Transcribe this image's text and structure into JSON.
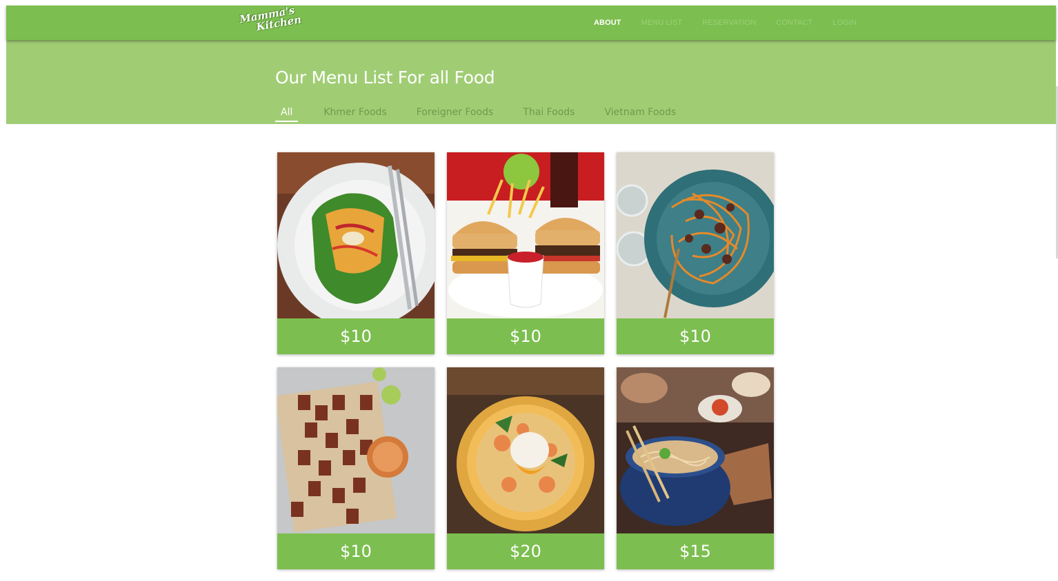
{
  "brand": {
    "logo_line1": "Mamma's",
    "logo_line2": "Kitchen"
  },
  "nav": {
    "items": [
      {
        "label": "ABOUT",
        "active": true
      },
      {
        "label": "MENU LIST",
        "active": false
      },
      {
        "label": "RESERVATION",
        "active": false
      },
      {
        "label": "CONTACT",
        "active": false
      },
      {
        "label": "LOGIN",
        "active": false
      }
    ]
  },
  "page": {
    "title": "Our Menu List For all Food"
  },
  "filters": [
    {
      "label": "All",
      "active": true
    },
    {
      "label": "Khmer Foods",
      "active": false
    },
    {
      "label": "Foreigner Foods",
      "active": false
    },
    {
      "label": "Thai Foods",
      "active": false
    },
    {
      "label": "Vietnam Foods",
      "active": false
    }
  ],
  "menu_items": [
    {
      "price": "$10",
      "image": "amok-icon"
    },
    {
      "price": "$10",
      "image": "burger-icon"
    },
    {
      "price": "$10",
      "image": "spaghetti-icon"
    },
    {
      "price": "$10",
      "image": "skewers-icon"
    },
    {
      "price": "$20",
      "image": "egg-bowl-icon"
    },
    {
      "price": "$15",
      "image": "noodle-bowl-icon"
    }
  ],
  "colors": {
    "primary": "#7cbe4f",
    "header_band": "#a0cd74",
    "inactive_text": "#9bd07a"
  }
}
